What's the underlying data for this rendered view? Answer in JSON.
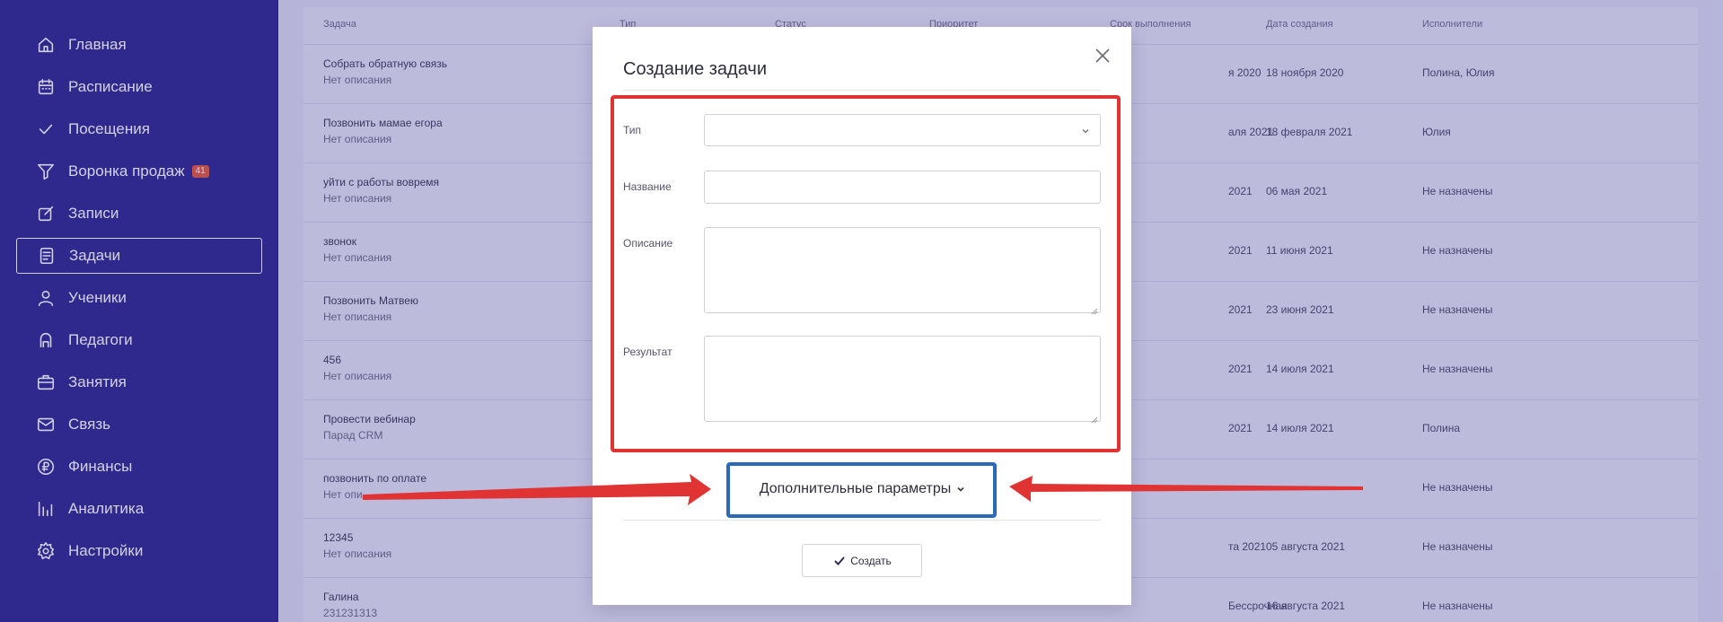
{
  "colors": {
    "sidebar_bg": "#302a8e",
    "highlight_red": "#e03434",
    "highlight_blue": "#2a6ab7",
    "badge": "#e05a3a"
  },
  "sidebar": {
    "items": [
      {
        "label": "Главная",
        "icon": "home-icon"
      },
      {
        "label": "Расписание",
        "icon": "calendar-icon"
      },
      {
        "label": "Посещения",
        "icon": "check-icon"
      },
      {
        "label": "Воронка продаж",
        "icon": "funnel-icon",
        "badge": "41"
      },
      {
        "label": "Записи",
        "icon": "edit-icon"
      },
      {
        "label": "Задачи",
        "icon": "tasks-icon",
        "active": true
      },
      {
        "label": "Ученики",
        "icon": "user-icon"
      },
      {
        "label": "Педагоги",
        "icon": "teacher-icon"
      },
      {
        "label": "Занятия",
        "icon": "briefcase-icon"
      },
      {
        "label": "Связь",
        "icon": "mail-icon"
      },
      {
        "label": "Финансы",
        "icon": "ruble-icon"
      },
      {
        "label": "Аналитика",
        "icon": "chart-icon"
      },
      {
        "label": "Настройки",
        "icon": "gear-icon"
      }
    ]
  },
  "table": {
    "headers": [
      "Задача",
      "Тип",
      "Статус",
      "Приоритет",
      "Срок выполнения",
      "Дата создания",
      "Исполнители"
    ],
    "rows": [
      {
        "title": "Собрать обратную связь",
        "desc": "Нет описания",
        "due": "я 2020",
        "created": "18 ноября 2020",
        "assignee": "Полина, Юлия"
      },
      {
        "title": "Позвонить мамае егора",
        "desc": "Нет описания",
        "due": "аля 2021",
        "created": "18 февраля 2021",
        "assignee": "Юлия"
      },
      {
        "title": "уйти с работы вовремя",
        "desc": "Нет описания",
        "due": "2021",
        "created": "06 мая 2021",
        "assignee": "Не назначены"
      },
      {
        "title": "звонок",
        "desc": "Нет описания",
        "due": "2021",
        "created": "11 июня 2021",
        "assignee": "Не назначены"
      },
      {
        "title": "Позвонить Матвею",
        "desc": "Нет описания",
        "due": "2021",
        "created": "23 июня 2021",
        "assignee": "Не назначены"
      },
      {
        "title": "456",
        "desc": "Нет описания",
        "due": "2021",
        "created": "14 июля 2021",
        "assignee": "Не назначены"
      },
      {
        "title": "Провести вебинар",
        "desc": "Парад CRM",
        "due": "2021",
        "created": "14 июля 2021",
        "assignee": "Полина"
      },
      {
        "title": "позвонить по оплате",
        "desc": "Нет опи",
        "due": "",
        "created": "",
        "assignee": "Не назначены"
      },
      {
        "title": "12345",
        "desc": "Нет описания",
        "due": "та 2021",
        "created": "05 августа 2021",
        "assignee": "Не назначены"
      },
      {
        "title": "Галина",
        "desc": "231231313",
        "due": "Бессрочная",
        "created": "16 августа 2021",
        "assignee": "Не назначены"
      }
    ]
  },
  "modal": {
    "title": "Создание задачи",
    "fields": {
      "type_label": "Тип",
      "name_label": "Название",
      "desc_label": "Описание",
      "result_label": "Результат"
    },
    "advanced_label": "Дополнительные параметры",
    "create_label": "Создать"
  }
}
